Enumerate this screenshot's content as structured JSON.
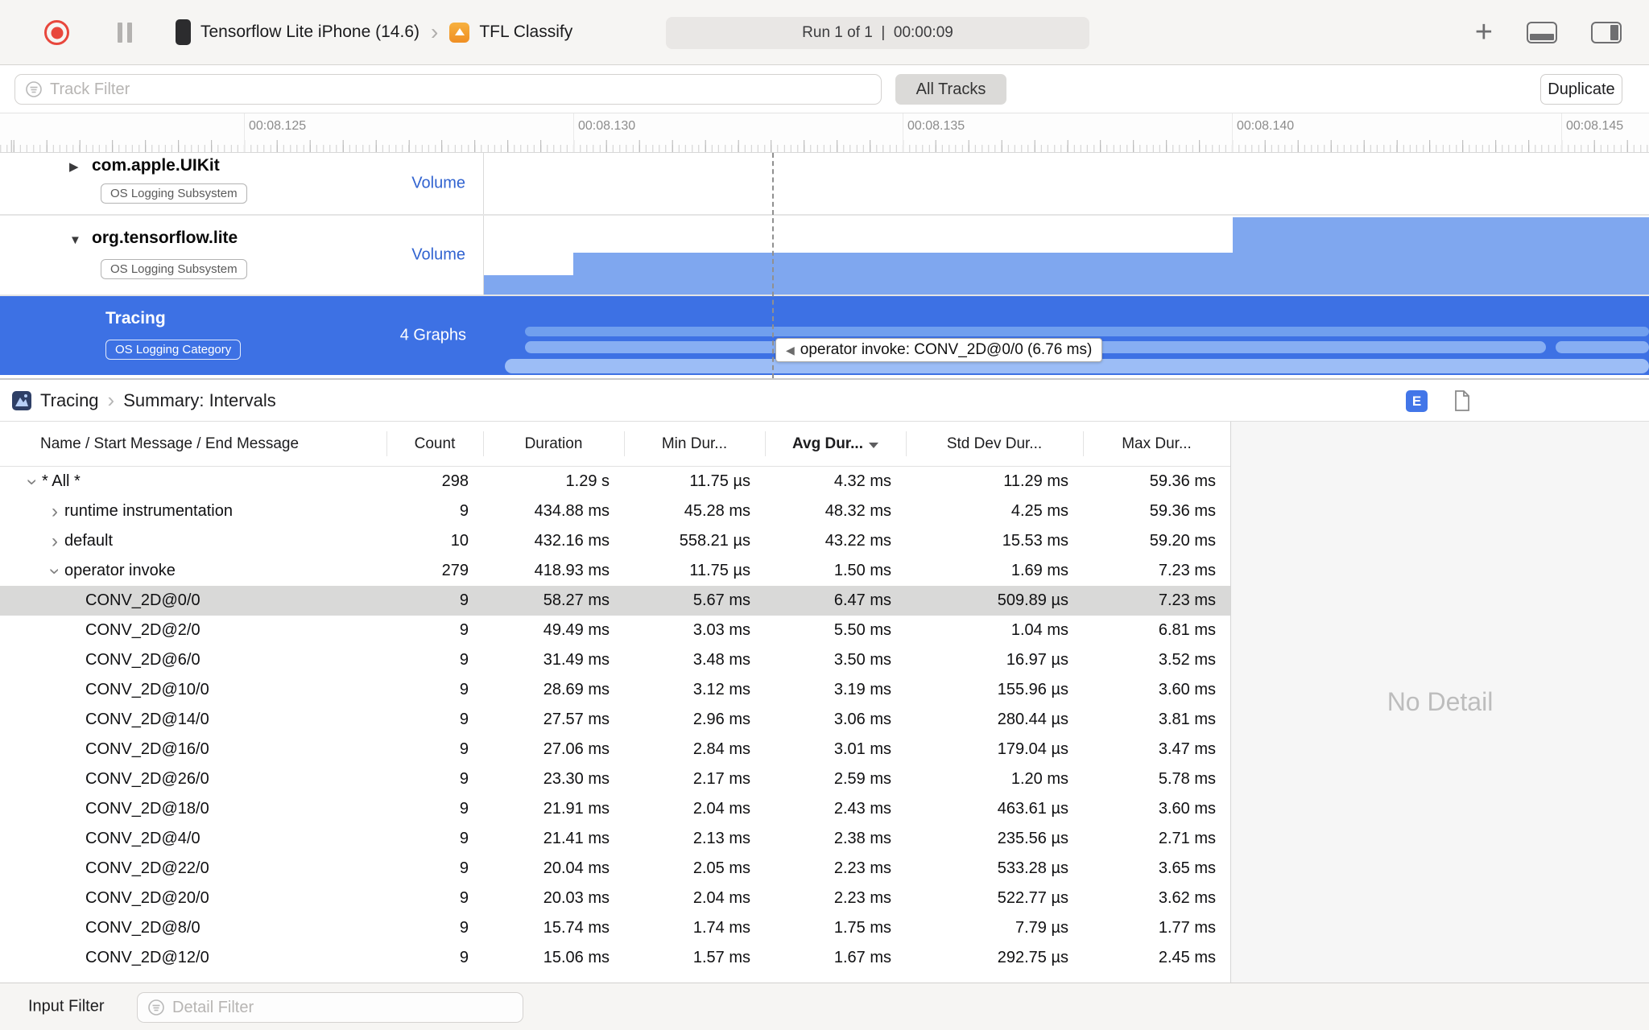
{
  "toolbar": {
    "device": "Tensorflow Lite iPhone (14.6)",
    "app": "TFL Classify",
    "run_status": "Run 1 of 1  |  00:00:09",
    "plus": "+"
  },
  "filter_bar": {
    "track_filter_placeholder": "Track Filter",
    "all_tracks": "All Tracks",
    "duplicate": "Duplicate"
  },
  "ruler": {
    "labels": [
      "00:08.125",
      "00:08.130",
      "00:08.135",
      "00:08.140",
      "00:08.145"
    ]
  },
  "tracks": [
    {
      "name": "com.apple.UIKit",
      "badge": "OS Logging Subsystem",
      "kind": "Volume"
    },
    {
      "name": "org.tensorflow.lite",
      "badge": "OS Logging Subsystem",
      "kind": "Volume"
    },
    {
      "name": "Tracing",
      "badge": "OS Logging Category",
      "kind": "4 Graphs"
    }
  ],
  "tooltip": "operator invoke: CONV_2D@0/0 (6.76 ms)",
  "detail_header": {
    "breadcrumb_root": "Tracing",
    "breadcrumb_leaf": "Summary: Intervals",
    "e_badge": "E"
  },
  "table": {
    "columns": [
      "Name / Start Message / End Message",
      "Count",
      "Duration",
      "Min Dur...",
      "Avg Dur...",
      "Std Dev Dur...",
      "Max Dur..."
    ],
    "sort_column": "Avg Dur...",
    "rows": [
      {
        "name": "* All *",
        "indent": 0,
        "disclosure": "expanded",
        "count": "298",
        "duration": "1.29 s",
        "min": "11.75 µs",
        "avg": "4.32 ms",
        "std": "11.29 ms",
        "max": "59.36 ms"
      },
      {
        "name": "runtime instrumentation",
        "indent": 1,
        "disclosure": "collapsed",
        "count": "9",
        "duration": "434.88 ms",
        "min": "45.28 ms",
        "avg": "48.32 ms",
        "std": "4.25 ms",
        "max": "59.36 ms"
      },
      {
        "name": "default",
        "indent": 1,
        "disclosure": "collapsed",
        "count": "10",
        "duration": "432.16 ms",
        "min": "558.21 µs",
        "avg": "43.22 ms",
        "std": "15.53 ms",
        "max": "59.20 ms"
      },
      {
        "name": "operator invoke",
        "indent": 1,
        "disclosure": "expanded",
        "count": "279",
        "duration": "418.93 ms",
        "min": "11.75 µs",
        "avg": "1.50 ms",
        "std": "1.69 ms",
        "max": "7.23 ms"
      },
      {
        "name": "CONV_2D@0/0",
        "indent": 2,
        "selected": true,
        "count": "9",
        "duration": "58.27 ms",
        "min": "5.67 ms",
        "avg": "6.47 ms",
        "std": "509.89 µs",
        "max": "7.23 ms"
      },
      {
        "name": "CONV_2D@2/0",
        "indent": 2,
        "count": "9",
        "duration": "49.49 ms",
        "min": "3.03 ms",
        "avg": "5.50 ms",
        "std": "1.04 ms",
        "max": "6.81 ms"
      },
      {
        "name": "CONV_2D@6/0",
        "indent": 2,
        "count": "9",
        "duration": "31.49 ms",
        "min": "3.48 ms",
        "avg": "3.50 ms",
        "std": "16.97 µs",
        "max": "3.52 ms"
      },
      {
        "name": "CONV_2D@10/0",
        "indent": 2,
        "count": "9",
        "duration": "28.69 ms",
        "min": "3.12 ms",
        "avg": "3.19 ms",
        "std": "155.96 µs",
        "max": "3.60 ms"
      },
      {
        "name": "CONV_2D@14/0",
        "indent": 2,
        "count": "9",
        "duration": "27.57 ms",
        "min": "2.96 ms",
        "avg": "3.06 ms",
        "std": "280.44 µs",
        "max": "3.81 ms"
      },
      {
        "name": "CONV_2D@16/0",
        "indent": 2,
        "count": "9",
        "duration": "27.06 ms",
        "min": "2.84 ms",
        "avg": "3.01 ms",
        "std": "179.04 µs",
        "max": "3.47 ms"
      },
      {
        "name": "CONV_2D@26/0",
        "indent": 2,
        "count": "9",
        "duration": "23.30 ms",
        "min": "2.17 ms",
        "avg": "2.59 ms",
        "std": "1.20 ms",
        "max": "5.78 ms"
      },
      {
        "name": "CONV_2D@18/0",
        "indent": 2,
        "count": "9",
        "duration": "21.91 ms",
        "min": "2.04 ms",
        "avg": "2.43 ms",
        "std": "463.61 µs",
        "max": "3.60 ms"
      },
      {
        "name": "CONV_2D@4/0",
        "indent": 2,
        "count": "9",
        "duration": "21.41 ms",
        "min": "2.13 ms",
        "avg": "2.38 ms",
        "std": "235.56 µs",
        "max": "2.71 ms"
      },
      {
        "name": "CONV_2D@22/0",
        "indent": 2,
        "count": "9",
        "duration": "20.04 ms",
        "min": "2.05 ms",
        "avg": "2.23 ms",
        "std": "533.28 µs",
        "max": "3.65 ms"
      },
      {
        "name": "CONV_2D@20/0",
        "indent": 2,
        "count": "9",
        "duration": "20.03 ms",
        "min": "2.04 ms",
        "avg": "2.23 ms",
        "std": "522.77 µs",
        "max": "3.62 ms"
      },
      {
        "name": "CONV_2D@8/0",
        "indent": 2,
        "count": "9",
        "duration": "15.74 ms",
        "min": "1.74 ms",
        "avg": "1.75 ms",
        "std": "7.79 µs",
        "max": "1.77 ms"
      },
      {
        "name": "CONV_2D@12/0",
        "indent": 2,
        "count": "9",
        "duration": "15.06 ms",
        "min": "1.57 ms",
        "avg": "1.67 ms",
        "std": "292.75 µs",
        "max": "2.45 ms"
      }
    ]
  },
  "right_panel": {
    "empty_text": "No Detail"
  },
  "bottom_bar": {
    "label": "Input Filter",
    "detail_filter_placeholder": "Detail Filter"
  }
}
